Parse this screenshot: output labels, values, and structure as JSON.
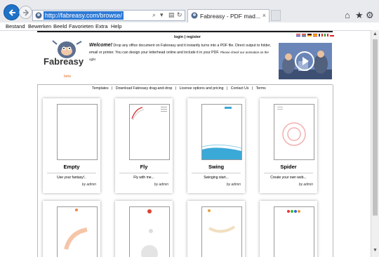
{
  "browser": {
    "url": "http://fabreasy.com/browse/",
    "tab_title": "Fabreasy - PDF mad...",
    "tab_close": "×"
  },
  "menu": [
    "Bestand",
    "Bewerken",
    "Beeld",
    "Favorieten",
    "Extra",
    "Help"
  ],
  "header": {
    "login": "login | register",
    "brand": "Fabreasy",
    "beta": "beta",
    "welcome_heading": "Welcome!",
    "welcome_text": " Drop any office document on Fabreasy and it instantly turns into a PDF file. Direct output to folder, email or printer. You can design your letterhead online and include it in your PDF. ",
    "welcome_note": "Please check our animation on the right."
  },
  "nav_links": [
    "Templates",
    "|",
    "Download Fabreasy drag-and-drop",
    "|",
    "License options and pricing",
    "|",
    "Contact Us",
    "|",
    "Terms"
  ],
  "templates": [
    {
      "name": "Empty",
      "desc": "Use your fantasy!..",
      "author": "by admin"
    },
    {
      "name": "Fly",
      "desc": "Fly with me...",
      "author": "by admin"
    },
    {
      "name": "Swing",
      "desc": "Swinging start...",
      "author": "by admin"
    },
    {
      "name": "Spider",
      "desc": "Create your own web...",
      "author": "by admin"
    }
  ],
  "colors": {
    "accent": "#1e73c8",
    "fly_red": "#d22020",
    "swing_blue": "#3aa9d8",
    "spider_pink": "#f3b0b0",
    "orange": "#e8864a"
  }
}
